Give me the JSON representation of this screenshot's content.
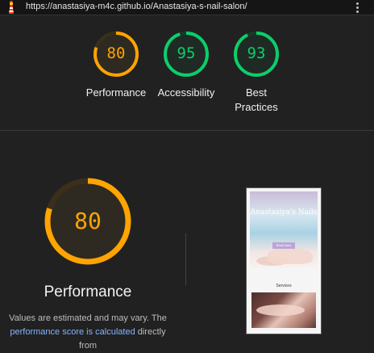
{
  "topbar": {
    "url": "https://anastasiya-m4c.github.io/Anastasiya-s-nail-salon/",
    "logo_icon": "lighthouse-icon",
    "menu_icon": "more-vert-icon"
  },
  "colors": {
    "average": "#ffa400",
    "pass": "#0cce6b",
    "track_average": "#3b2f1a",
    "track_pass": "#173a28"
  },
  "summary_gauges": [
    {
      "label": "Performance",
      "score": "80",
      "fraction": 0.8,
      "rating": "average"
    },
    {
      "label": "Accessibility",
      "score": "95",
      "fraction": 0.95,
      "rating": "pass"
    },
    {
      "label": "Best Practices",
      "score": "93",
      "fraction": 0.93,
      "rating": "pass"
    }
  ],
  "performance": {
    "score": "80",
    "fraction": 0.8,
    "title": "Performance",
    "note_before": "Values are estimated and may vary. The",
    "note_link": "performance score is calculated",
    "note_after": " directly from"
  },
  "screenshot": {
    "site_title": "Anastasiya's Nails",
    "button_label": "Book Now",
    "section_label": "Services"
  }
}
